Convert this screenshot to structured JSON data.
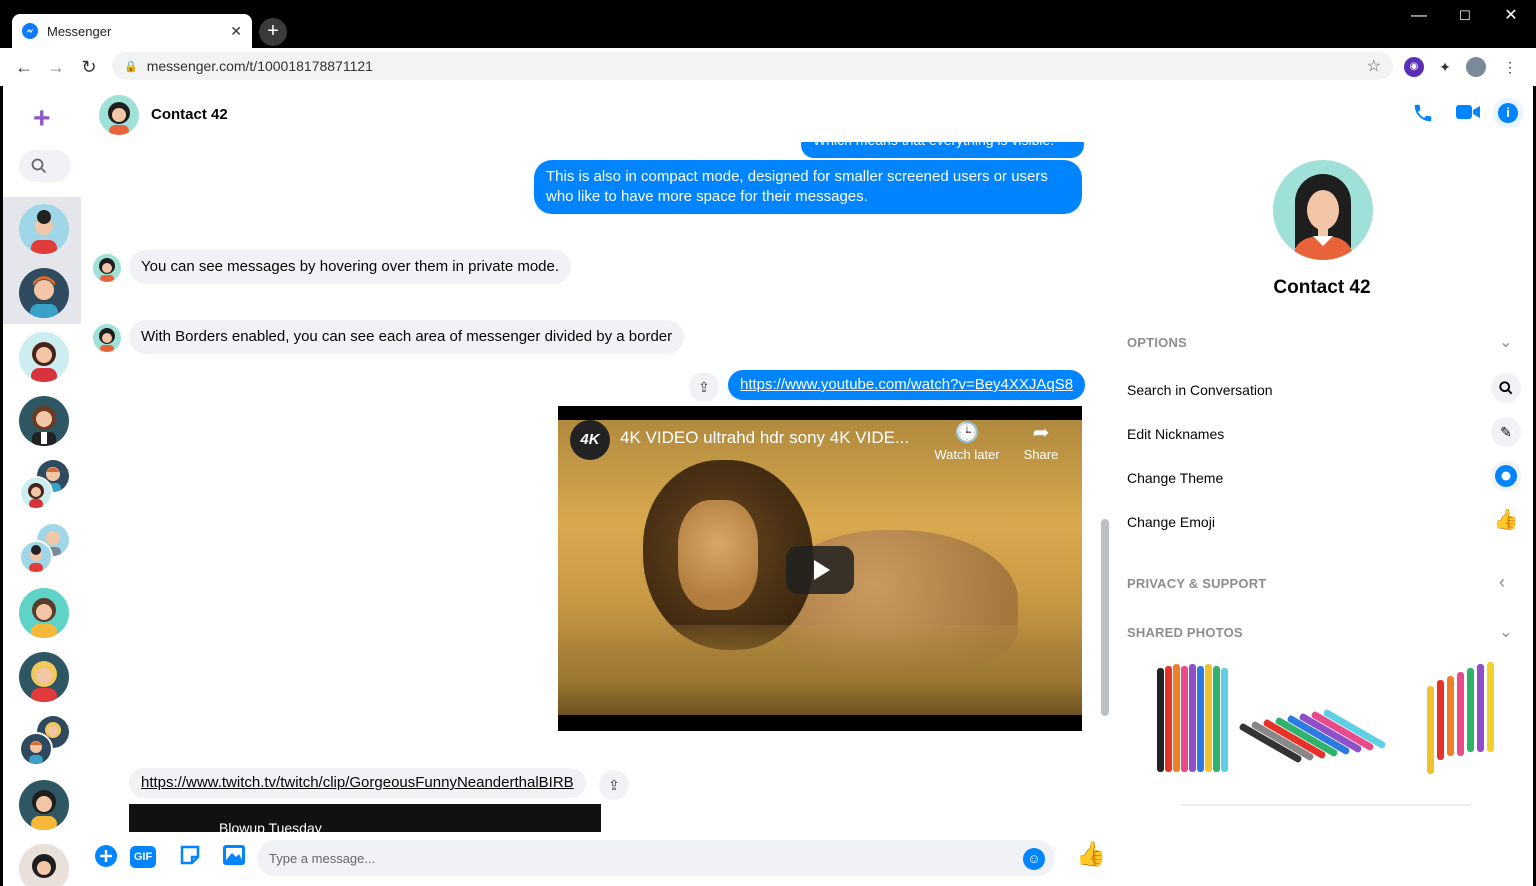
{
  "browser": {
    "tab_title": "Messenger",
    "tab_close": "✕",
    "new_tab": "+",
    "url": "messenger.com/t/100018178871121",
    "window_controls": [
      "—",
      "☐",
      "✕"
    ]
  },
  "chat": {
    "contact_name": "Contact 42"
  },
  "messages": {
    "cut_off": "Which means that everything is visible.",
    "outgoing_1": "This is also in compact mode, designed for smaller screened users or users who like to have more space for their messages.",
    "incoming_1": "You can see messages by hovering over them in private mode.",
    "incoming_2": "With Borders enabled, you can see each area of messenger divided by a border",
    "link_out": "https://www.youtube.com/watch?v=Bey4XXJAqS8",
    "video_title": "4K VIDEO ultrahd hdr sony 4K VIDE...",
    "video_logo": "4K",
    "watch_later": "Watch later",
    "share": "Share",
    "link_in": "https://www.twitch.tv/twitch/clip/GorgeousFunnyNeanderthalBIRB",
    "twitch_title": "Blowup Tuesday"
  },
  "composer": {
    "placeholder": "Type a message...",
    "gif": "GIF"
  },
  "panel": {
    "name": "Contact 42",
    "options_header": "OPTIONS",
    "options": [
      "Search in Conversation",
      "Edit Nicknames",
      "Change Theme",
      "Change Emoji"
    ],
    "privacy_header": "PRIVACY & SUPPORT",
    "photos_header": "SHARED PHOTOS"
  },
  "colors": {
    "accent": "#0084ff",
    "bubble_in": "#f0f2f5",
    "plus": "#8e55c7"
  }
}
